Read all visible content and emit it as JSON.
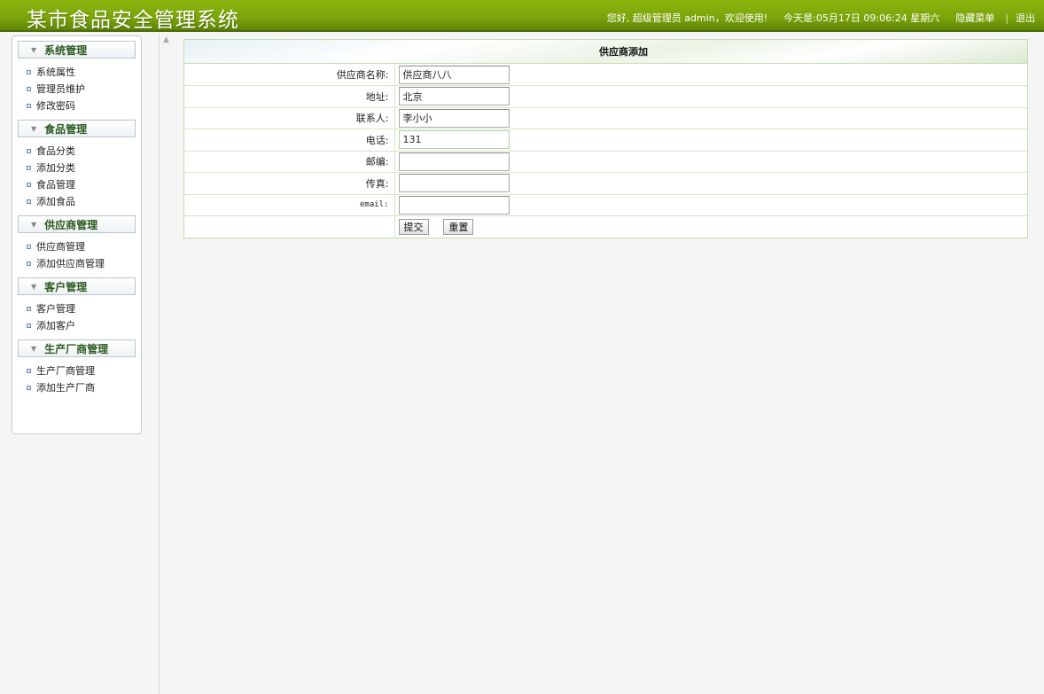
{
  "header": {
    "app_title": "某市食品安全管理系统",
    "greeting": "您好, 超级管理员 admin，欢迎使用!",
    "date_text": "今天是:05月17日 09:06:24 星期六",
    "hide_menu": "隐藏菜单",
    "logout": "退出"
  },
  "sidebar": {
    "groups": [
      {
        "title": "系统管理",
        "items": [
          "系统属性",
          "管理员维护",
          "修改密码"
        ]
      },
      {
        "title": "食品管理",
        "items": [
          "食品分类",
          "添加分类",
          "食品管理",
          "添加食品"
        ]
      },
      {
        "title": "供应商管理",
        "items": [
          "供应商管理",
          "添加供应商管理"
        ]
      },
      {
        "title": "客户管理",
        "items": [
          "客户管理",
          "添加客户"
        ]
      },
      {
        "title": "生产厂商管理",
        "items": [
          "生产厂商管理",
          "添加生产厂商"
        ]
      }
    ]
  },
  "form": {
    "title": "供应商添加",
    "fields": [
      {
        "label": "供应商名称:",
        "value": "供应商八八"
      },
      {
        "label": "地址:",
        "value": "北京"
      },
      {
        "label": "联系人:",
        "value": "李小小"
      },
      {
        "label": "电话:",
        "value": "131"
      },
      {
        "label": "邮编:",
        "value": ""
      },
      {
        "label": "传真:",
        "value": ""
      },
      {
        "label": "email:",
        "value": ""
      }
    ],
    "submit_label": "提交",
    "reset_label": "重置"
  },
  "colors": {
    "header_green": "#7aa40a",
    "menu_title": "#2b5a20",
    "form_border": "#c7dcb0"
  }
}
